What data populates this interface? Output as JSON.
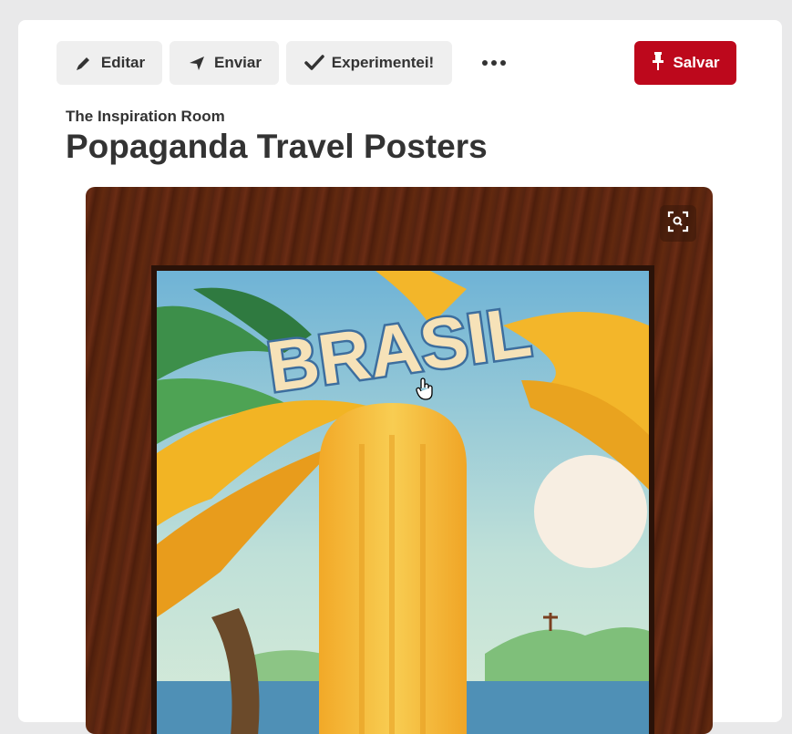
{
  "toolbar": {
    "edit_label": "Editar",
    "send_label": "Enviar",
    "tried_label": "Experimentei!",
    "more_icon": "ellipsis-icon",
    "save_label": "Salvar",
    "save_color": "#bd081c"
  },
  "pin": {
    "source": "The Inspiration Room",
    "title": "Popaganda Travel Posters"
  },
  "image": {
    "poster_text": "BRASIL",
    "zoom_icon": "visual-search-icon"
  }
}
